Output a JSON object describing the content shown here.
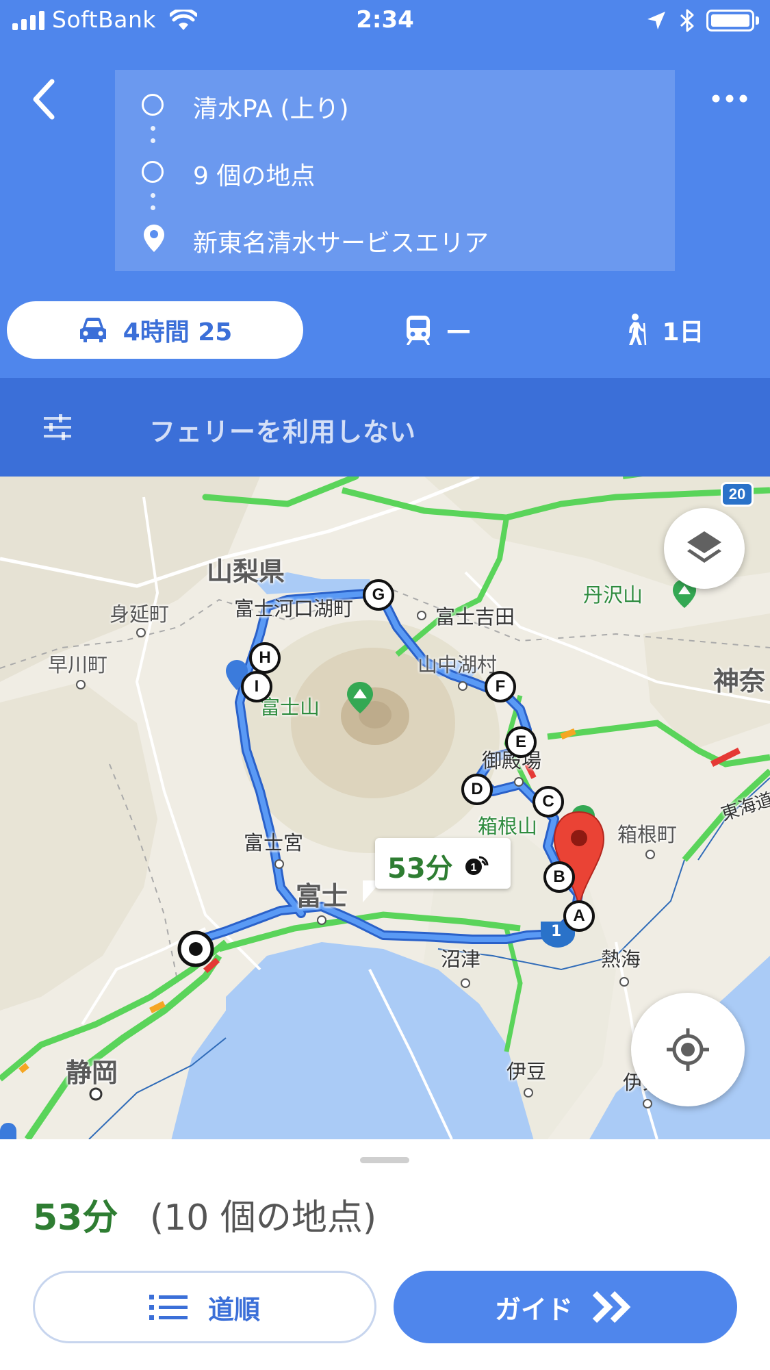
{
  "status_bar": {
    "carrier": "SoftBank",
    "time": "2:34"
  },
  "route": {
    "origin": "清水PA (上り)",
    "waypoints": "9 個の地点",
    "destination": "新東名清水サービスエリア"
  },
  "modes": {
    "drive": {
      "icon": "car-icon",
      "label": "4時間 25"
    },
    "transit": {
      "icon": "train-icon",
      "label": "—"
    },
    "walk": {
      "icon": "walking-person-icon",
      "label": "1日"
    }
  },
  "options": {
    "icon": "sliders-icon",
    "label": "フェリーを利用しない"
  },
  "map": {
    "place_labels": {
      "yamanashi": "山梨県",
      "minobu": "身延町",
      "hayakawa": "早川町",
      "kawaguchiko": "富士河口湖町",
      "fujiyoshida": "富士吉田",
      "tanzawa": "丹沢山",
      "yamanakako": "山中湖村",
      "kanagawa": "神奈",
      "fujisan": "富士山",
      "gotemba": "御殿場",
      "hakoneyama": "箱根山",
      "hakonemachi": "箱根町",
      "fujinomiya": "富士宮",
      "fuji": "富士",
      "numazu": "沼津",
      "atami": "熱海",
      "shizuoka": "静岡",
      "izu": "伊豆",
      "ito": "伊東",
      "tokaido": "東海道"
    },
    "route_shield": "20",
    "road_number": "1",
    "waypoint_markers": [
      "A",
      "B",
      "C",
      "D",
      "E",
      "F",
      "G",
      "H",
      "I"
    ],
    "eta_bubble": "53分",
    "colors": {
      "route": "#4285f4",
      "traffic_ok": "#5ad45a",
      "traffic_slow": "#f5a623",
      "traffic_jam": "#e53935",
      "destination_pin": "#ea4335"
    }
  },
  "sheet": {
    "duration": "53分",
    "stops": "(10 個の地点)",
    "steps_label": "道順",
    "guide_label": "ガイド"
  }
}
